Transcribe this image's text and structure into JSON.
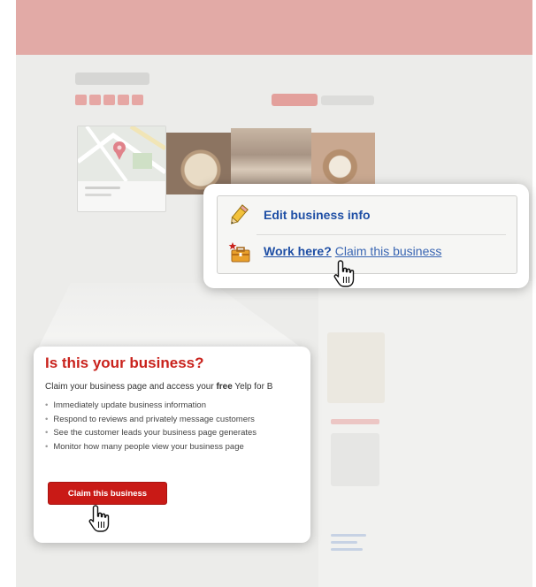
{
  "popup_top": {
    "edit_label": "Edit business info",
    "work_here": "Work here?",
    "claim_link": "Claim this business"
  },
  "card": {
    "title": "Is this your business?",
    "intro_before": "Claim your business page and access your ",
    "intro_bold": "free",
    "intro_after": " Yelp for B",
    "bullets": [
      "Immediately update business information",
      "Respond to reviews and privately message customers",
      "See the customer leads your business page generates",
      "Monitor how many people view your business page"
    ],
    "button_label": "Claim this business"
  },
  "colors": {
    "accent_red": "#c91a16",
    "link_blue": "#1f4fa5",
    "header_pink": "#e2aaa6"
  },
  "icons": [
    "pencil-icon",
    "briefcase-star-icon",
    "hand-cursor-icon"
  ]
}
